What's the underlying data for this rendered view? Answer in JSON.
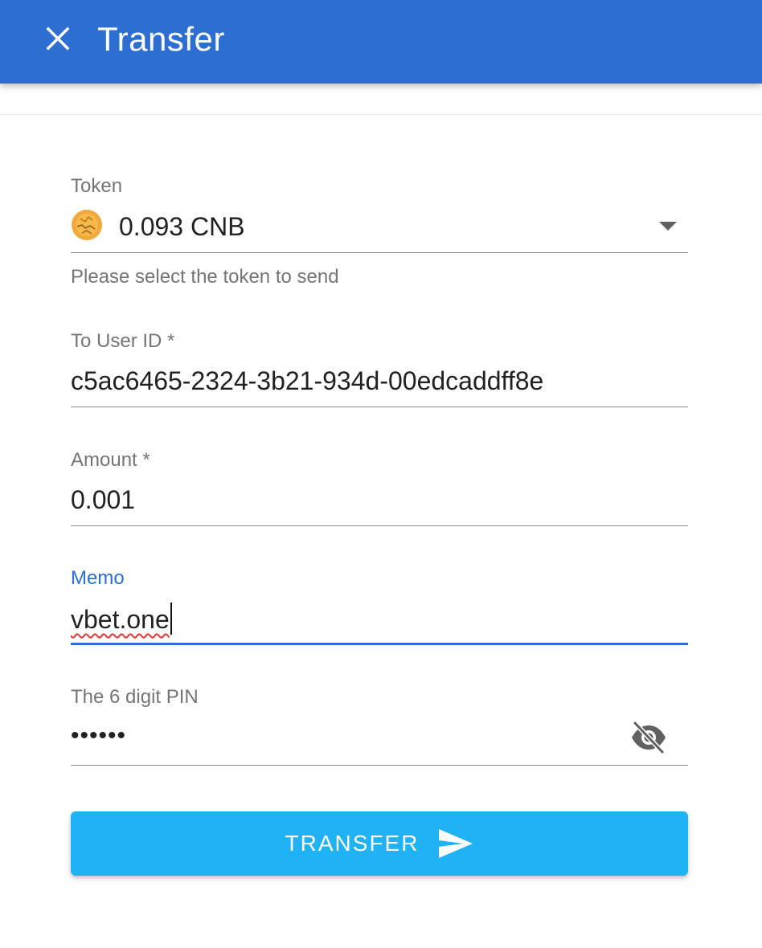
{
  "appbar": {
    "title": "Transfer",
    "close_icon": "close-icon",
    "color": "#2d6fd0"
  },
  "form": {
    "token": {
      "label": "Token",
      "value": "0.093 CNB",
      "icon": "token-coin-icon",
      "helper": "Please select the token to send"
    },
    "to_user": {
      "label": "To User ID *",
      "value": "c5ac6465-2324-3b21-934d-00edcaddff8e"
    },
    "amount": {
      "label": "Amount *",
      "value": "0.001"
    },
    "memo": {
      "label": "Memo",
      "value": "vbet.one",
      "focused": true
    },
    "pin": {
      "label": "The 6 digit PIN",
      "value": "••••••",
      "visibility_icon": "visibility-off-icon"
    }
  },
  "submit": {
    "label": "TRANSFER",
    "icon": "send-icon",
    "color": "#1fb2f5"
  }
}
